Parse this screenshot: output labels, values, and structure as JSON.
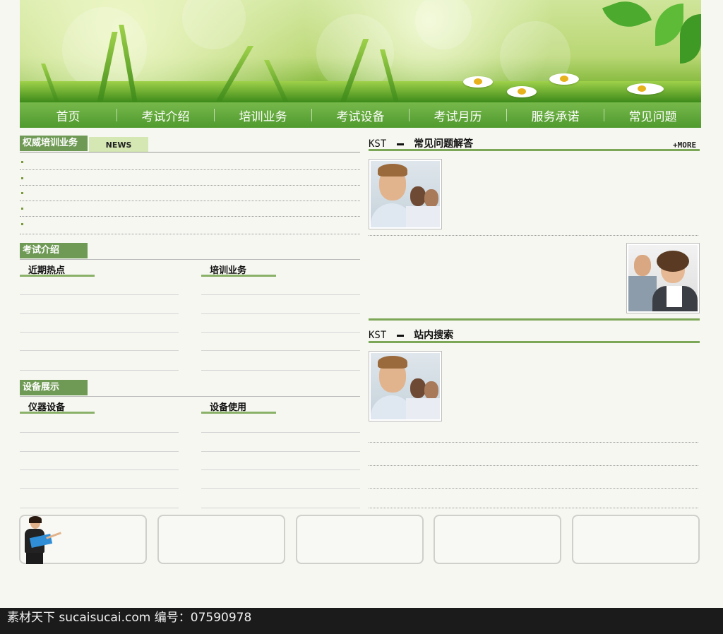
{
  "nav": {
    "items": [
      "首页",
      "考试介绍",
      "培训业务",
      "考试设备",
      "考试月历",
      "服务承诺",
      "常见问题"
    ]
  },
  "news_section": {
    "title": "权威培训业务",
    "tab": "NEWS"
  },
  "exam_intro": {
    "title": "考试介绍",
    "left_sub": "近期热点",
    "right_sub": "培训业务"
  },
  "equipment": {
    "title": "设备展示",
    "left_sub": "仪器设备",
    "right_sub": "设备使用"
  },
  "faq": {
    "prefix": "KST",
    "title": "常见问题解答",
    "more": "+MORE"
  },
  "search": {
    "prefix": "KST",
    "title": "站内搜索"
  },
  "footer": {
    "text": "素材天下 sucaisucai.com  编号：07590978"
  },
  "colors": {
    "nav_green": "#5fa83a",
    "tag_green": "#6f9a55",
    "accent_bar": "#7ca756"
  }
}
